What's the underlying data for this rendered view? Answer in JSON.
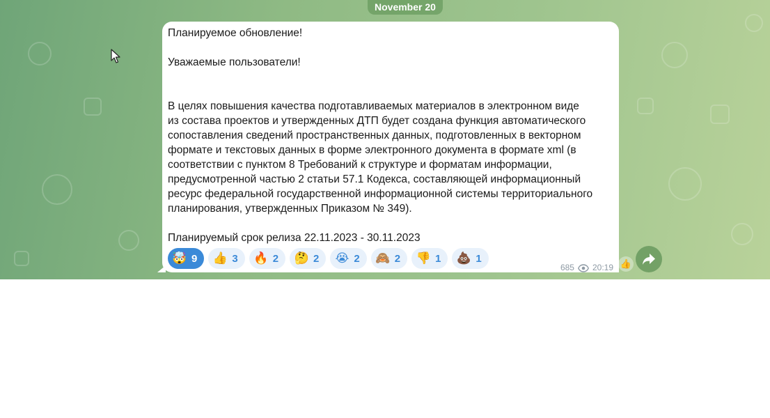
{
  "date_separator": "November 20",
  "message": {
    "lines": [
      "Планируемое обновление!",
      "",
      "Уважаемые пользователи!",
      "",
      "",
      "В целях повышения качества подготавливаемых материалов в электронном виде",
      "из состава проектов и утвержденных ДТП будет создана функция автоматического",
      "сопоставления сведений пространственных данных, подготовленных в векторном",
      "формате и текстовых данных в форме электронного документа в формате xml (в",
      "соответствии с пунктом 8 Требований к структуре и форматам информации,",
      "предусмотренной частью 2 статьи 57.1 Кодекса, составляющей информационный",
      "ресурс федеральной государственной информационной системы территориального",
      "планирования, утвержденных Приказом № 349).",
      "",
      "Планируемый срок релиза 22.11.2023 - 30.11.2023"
    ],
    "views": "685",
    "time": "20:19"
  },
  "reactions": [
    {
      "emoji": "🤯",
      "count": "9",
      "active": true
    },
    {
      "emoji": "👍",
      "count": "3",
      "active": false
    },
    {
      "emoji": "🔥",
      "count": "2",
      "active": false
    },
    {
      "emoji": "🤔",
      "count": "2",
      "active": false
    },
    {
      "emoji": "😭",
      "count": "2",
      "active": false
    },
    {
      "emoji": "🙈",
      "count": "2",
      "active": false
    },
    {
      "emoji": "👎",
      "count": "1",
      "active": false
    },
    {
      "emoji": "💩",
      "count": "1",
      "active": false
    }
  ],
  "mini_reaction_emoji": "👍",
  "icons": {
    "views": "eye-icon",
    "forward": "forward-arrow-icon"
  },
  "colors": {
    "reaction_accent": "#3b8ad8",
    "reaction_bg": "#e8f1fb",
    "bubble_bg": "#ffffff"
  }
}
